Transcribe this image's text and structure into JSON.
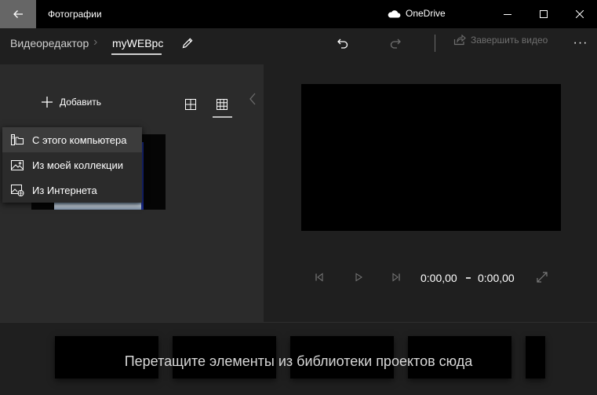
{
  "titlebar": {
    "app_title": "Фотографии",
    "onedrive_label": "OneDrive",
    "icons": {
      "back": "back-arrow-icon",
      "cloud": "cloud-icon",
      "minimize": "minimize-icon",
      "maximize": "maximize-icon",
      "close": "close-icon"
    }
  },
  "breadcrumb": {
    "editor": "Видеоредактор",
    "project": "myWEBpc"
  },
  "commandbar": {
    "finish_label": "Завершить видео",
    "more_label": "···",
    "icons": {
      "rename": "pencil-icon",
      "undo": "undo-icon",
      "redo": "redo-icon",
      "finish": "share-icon",
      "more": "more-icon"
    }
  },
  "library": {
    "add_label": "Добавить",
    "menu": [
      {
        "label": "С этого компьютера",
        "icon": "computer-folder-icon",
        "selected": true
      },
      {
        "label": "Из моей коллекции",
        "icon": "photo-icon",
        "selected": false
      },
      {
        "label": "Из Интернета",
        "icon": "photo-globe-icon",
        "selected": false
      }
    ]
  },
  "preview": {
    "time_current": "0:00,00",
    "time_total": "0:00,00"
  },
  "storyboard": {
    "hint": "Перетащите элементы из библиотеки проектов сюда"
  },
  "colors": {
    "titlebar_bg": "#000000",
    "back_button_bg": "#666666",
    "app_bg": "#1f1f1f",
    "panel_bg": "#2b2b2b",
    "menu_selected_bg": "#3c3c3c",
    "disabled_text": "#6f6f6f"
  }
}
